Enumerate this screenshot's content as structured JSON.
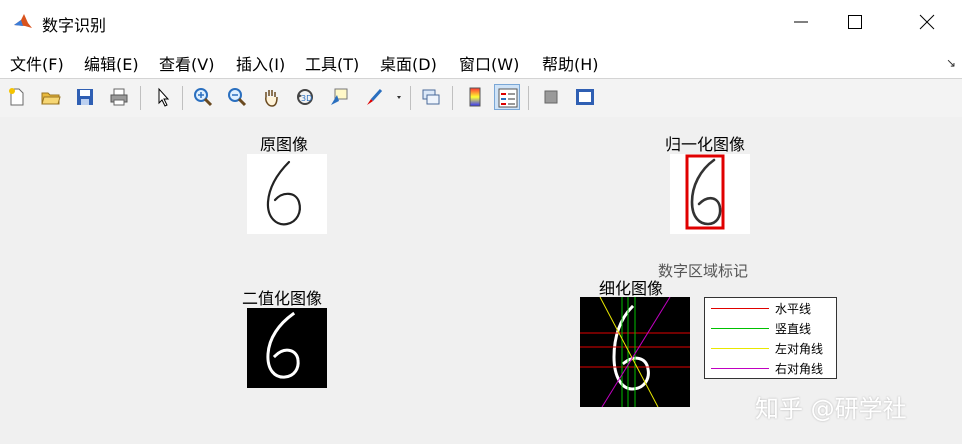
{
  "window": {
    "title": "数字识别"
  },
  "menubar": {
    "items": [
      "文件(F)",
      "编辑(E)",
      "查看(V)",
      "插入(I)",
      "工具(T)",
      "桌面(D)",
      "窗口(W)",
      "帮助(H)"
    ],
    "arrow": "↘"
  },
  "toolbar": {
    "icons": [
      "new-figure-icon",
      "open-file-icon",
      "save-icon",
      "print-icon",
      "pointer-icon",
      "zoom-in-icon",
      "zoom-out-icon",
      "pan-hand-icon",
      "rotate-3d-icon",
      "data-cursor-icon",
      "brush-icon",
      "link-plot-icon",
      "colorbar-icon",
      "legend-icon",
      "hide-plot-tools-icon",
      "show-plot-tools-icon"
    ],
    "pressed": "legend-icon"
  },
  "figure": {
    "panels": {
      "original": {
        "title": "原图像"
      },
      "normalized": {
        "title": "归一化图像",
        "box_color": "#e00000"
      },
      "binary": {
        "title": "二值化图像"
      },
      "thin": {
        "title": "细化图像"
      }
    },
    "region_label": "数字区域标记",
    "legend": [
      {
        "label": "水平线",
        "color": "#e00000"
      },
      {
        "label": "竖直线",
        "color": "#00c000"
      },
      {
        "label": "左对角线",
        "color": "#e8e800"
      },
      {
        "label": "右对角线",
        "color": "#c000c0"
      }
    ]
  },
  "watermark": "知乎 @研学社"
}
